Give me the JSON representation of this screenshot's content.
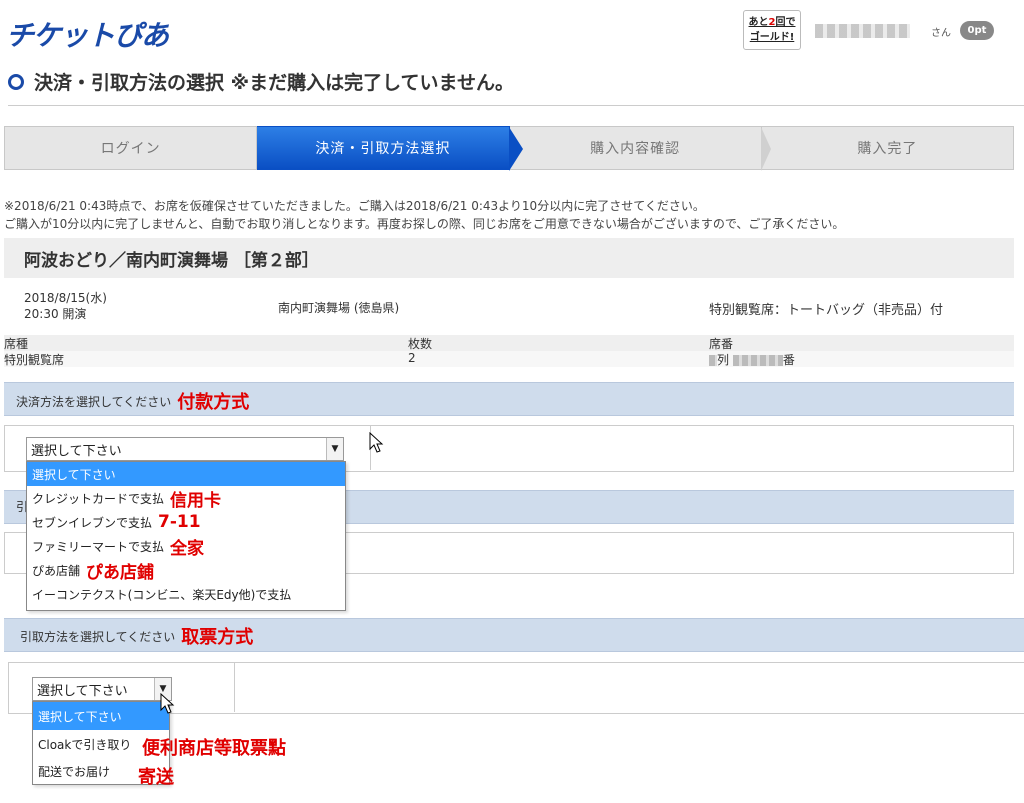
{
  "header": {
    "logo": "チケットぴあ",
    "gold_badge_line1_a": "あと",
    "gold_badge_line1_num": "2",
    "gold_badge_line1_b": "回で",
    "gold_badge_line2": "ゴールド!",
    "san": "さん",
    "points": "0pt"
  },
  "page_title": "決済・引取方法の選択 ※まだ購入は完了していません。",
  "steps": [
    "ログイン",
    "決済・引取方法選択",
    "購入内容確認",
    "購入完了"
  ],
  "notice": [
    "※2018/6/21 0:43時点で、お席を仮確保させていただきました。ご購入は2018/6/21 0:43より10分以内に完了させてください。",
    "ご購入が10分以内に完了しませんと、自動でお取り消しとなります。再度お探しの際、同じお席をご用意できない場合がございますので、ご了承ください。"
  ],
  "event": {
    "title": "阿波おどり／南内町演舞場 ［第２部］",
    "date": "2018/8/15(水)",
    "time": "20:30 開演",
    "venue": "南内町演舞場 (徳島県)",
    "note": "特別観覧席：トートバッグ（非売品）付"
  },
  "ticket_table": {
    "headers": [
      "席種",
      "枚数",
      "席番"
    ],
    "row": {
      "type": "特別観覧席",
      "count": "2",
      "seat_a": "列",
      "seat_b": "番"
    }
  },
  "payment": {
    "label": "決済方法を選択してください",
    "annotation": "付款方式",
    "select_value": "選択して下さい",
    "options": [
      {
        "label": "選択して下さい",
        "annotation": ""
      },
      {
        "label": "クレジットカードで支払",
        "annotation": "信用卡"
      },
      {
        "label": "セブンイレブンで支払",
        "annotation": "7-11"
      },
      {
        "label": "ファミリーマートで支払",
        "annotation": "全家"
      },
      {
        "label": "ぴあ店舗",
        "annotation": "ぴあ店鋪"
      },
      {
        "label": "イーコンテクスト(コンビニ、楽天Edy他)で支払",
        "annotation": ""
      }
    ]
  },
  "hidden_section_label": "引",
  "pickup": {
    "label": "引取方法を選択してください",
    "annotation": "取票方式",
    "select_value": "選択して下さい",
    "options": [
      {
        "label": "選択して下さい",
        "annotation": ""
      },
      {
        "label": "Cloakで引き取り",
        "annotation": "便利商店等取票點"
      },
      {
        "label": "配送でお届け",
        "annotation": "寄送"
      }
    ]
  },
  "colors": {
    "brand_blue": "#1a4aa8",
    "active_step": "#0a4fc4",
    "section_bar": "#cfdcec",
    "annotation_red": "#e00000",
    "option_highlight": "#3399ff"
  }
}
